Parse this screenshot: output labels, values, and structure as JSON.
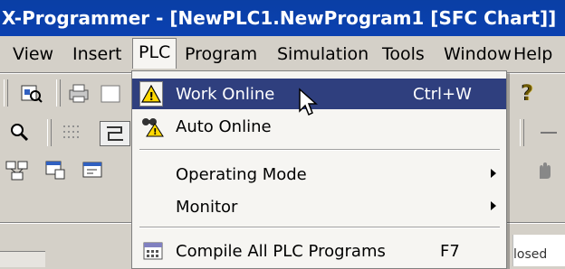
{
  "window": {
    "title": "X-Programmer - [NewPLC1.NewProgram1 [SFC Chart]]"
  },
  "menubar": {
    "items": [
      "View",
      "Insert",
      "PLC",
      "Program",
      "Simulation",
      "Tools",
      "Window",
      "Help"
    ],
    "active": "PLC"
  },
  "plc_menu": {
    "items": [
      {
        "label": "Work Online",
        "mnemonic": "W",
        "shortcut": "Ctrl+W",
        "icon": "warning-online-icon",
        "highlighted": true
      },
      {
        "label": "Auto Online",
        "mnemonic": "n",
        "shortcut": "",
        "icon": "binoculars-warning-icon",
        "highlighted": false
      },
      {
        "label": "Operating Mode",
        "mnemonic": "M",
        "shortcut": "",
        "submenu": true
      },
      {
        "label": "Monitor",
        "mnemonic": "o",
        "shortcut": "",
        "submenu": true
      },
      {
        "label": "Compile All PLC Programs",
        "mnemonic": "A",
        "shortcut": "F7",
        "icon": "compile-icon"
      }
    ]
  },
  "background": {
    "closed_text": "losed"
  },
  "colors": {
    "titlebar": "#0b40b0",
    "highlight": "#2f3f7e",
    "menu_bg": "#f6f5f2",
    "chrome": "#d4d0c8"
  }
}
